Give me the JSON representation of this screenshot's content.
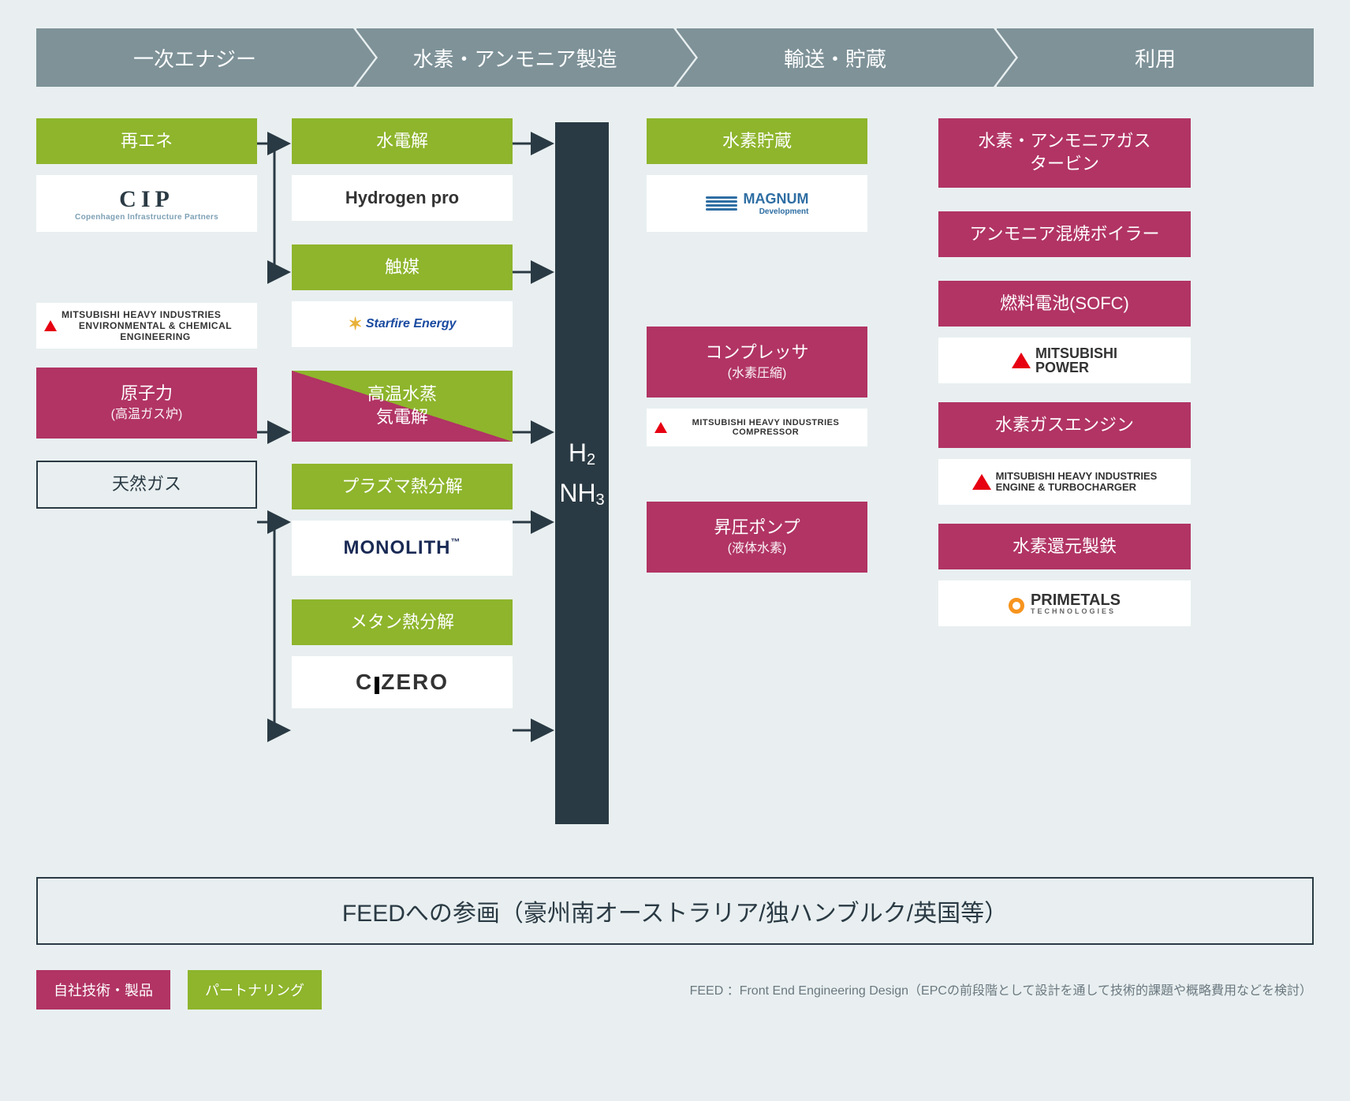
{
  "header": {
    "col1": "一次エナジー",
    "col2": "水素・アンモニア製造",
    "col3": "輸送・貯蔵",
    "col4": "利用"
  },
  "col1": {
    "renewable": "再エネ",
    "cip_main": "CIP",
    "cip_sub": "Copenhagen Infrastructure Partners",
    "mhi_line1": "MITSUBISHI HEAVY INDUSTRIES",
    "mhi_line2": "ENVIRONMENTAL & CHEMICAL ENGINEERING",
    "nuclear": "原子力",
    "nuclear_sub": "(高温ガス炉)",
    "natgas": "天然ガス"
  },
  "col2": {
    "electrolysis": "水電解",
    "hydrogenpro": "Hydrogen pro",
    "catalyst": "触媒",
    "starfire": "Starfire Energy",
    "hightemp_l1": "高温水蒸",
    "hightemp_l2": "気電解",
    "plasma": "プラズマ熱分解",
    "monolith": "MONOLITH",
    "methane": "メタン熱分解",
    "czero_c": "C",
    "czero_zero": "ZERO"
  },
  "center": {
    "h2": "H",
    "h2_sub": "2",
    "nh3": "NH",
    "nh3_sub": "3"
  },
  "col3": {
    "storage": "水素貯蔵",
    "magnum_main": "MAGNUM",
    "magnum_sub": "Development",
    "compressor": "コンプレッサ",
    "compressor_sub": "(水素圧縮)",
    "mhi_comp": "MITSUBISHI HEAVY INDUSTRIES COMPRESSOR",
    "pump": "昇圧ポンプ",
    "pump_sub": "(液体水素)"
  },
  "col4": {
    "gasturbine_l1": "水素・アンモニアガス",
    "gasturbine_l2": "タービン",
    "boiler": "アンモニア混焼ボイラー",
    "sofc": "燃料電池(SOFC)",
    "mpower_l1": "MITSUBISHI",
    "mpower_l2": "POWER",
    "gasengine": "水素ガスエンジン",
    "mhiet_l1": "MITSUBISHI HEAVY INDUSTRIES",
    "mhiet_l2": "ENGINE & TURBOCHARGER",
    "steel": "水素還元製鉄",
    "primetals_main": "PRIMETALS",
    "primetals_sub": "TECHNOLOGIES"
  },
  "feed_box": "FEEDへの参画（豪州南オーストラリア/独ハンブルク/英国等）",
  "legend": {
    "own": "自社技術・製品",
    "partner": "パートナリング"
  },
  "footnote": "FEED ：Front End Engineering Design（EPCの前段階として設計を通して技術的課題や概略費用などを検討）"
}
